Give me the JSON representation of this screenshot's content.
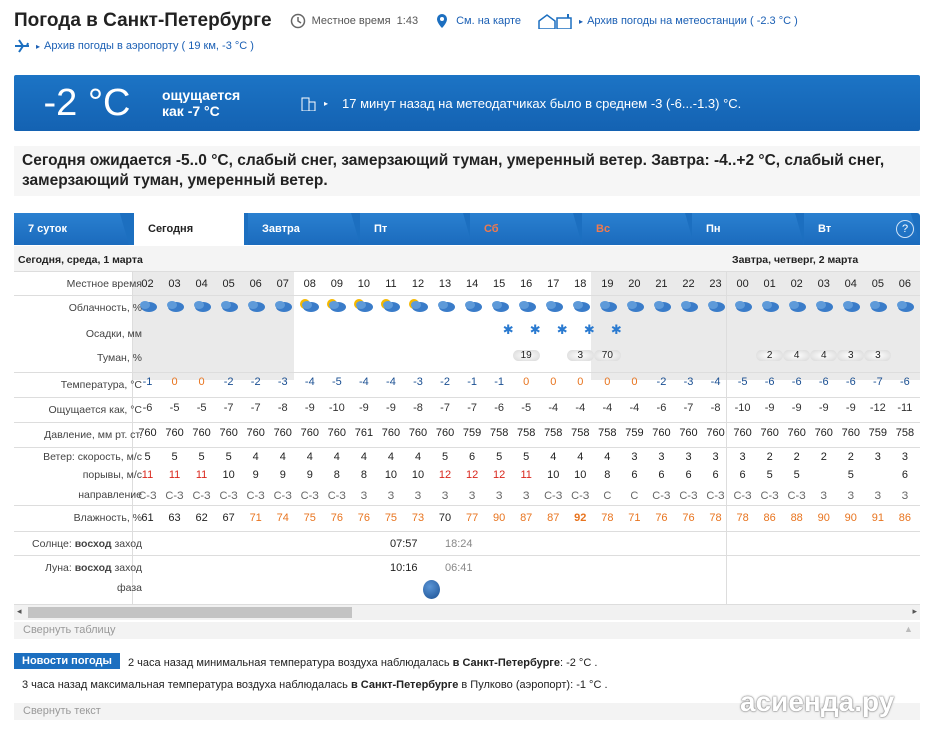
{
  "header": {
    "title": "Погода в Санкт-Петербурге",
    "local_time_label": "Местное время",
    "local_time": "1:43",
    "map_link": "См. на карте",
    "archive_station": "Архив погоды на метеостанции ( -2.3 °C )",
    "archive_airport": "Архив погоды в аэропорту ( 19 км, -3 °C )"
  },
  "current": {
    "temp": "-2 °C",
    "feels_line1": "ощущается",
    "feels_line2": "как -7 °C",
    "sensor_note": "17 минут назад на метеодатчиках было в среднем -3 (-6...-1.3) °C."
  },
  "forecast_text": "Сегодня ожидается -5..0 °C, слабый снег, замерзающий туман, умеренный ветер. Завтра: -4..+2 °C, слабый снег, замерзающий туман, умеренный ветер.",
  "tabs": [
    "7 суток",
    "Сегодня",
    "Завтра",
    "Пт",
    "Сб",
    "Вс",
    "Пн",
    "Вт"
  ],
  "help": "?",
  "day1": "Сегодня, среда, 1 марта",
  "day2": "Завтра, четверг, 2 марта",
  "labels": {
    "time": "Местное время",
    "cloud": "Облачность, %",
    "precip": "Осадки, мм",
    "fog": "Туман, %",
    "temp": "Температура, °C",
    "feels": "Ощущается как, °C",
    "pressure": "Давление, мм рт. ст.",
    "wind_speed": "Ветер: скорость, м/с",
    "gusts": "порывы, м/с",
    "direction": "направление",
    "humidity": "Влажность, %",
    "sun": "Солнце:",
    "moon": "Луна:",
    "rise": "восход",
    "set": "заход",
    "phase": "фаза"
  },
  "hours": [
    "02",
    "03",
    "04",
    "05",
    "06",
    "07",
    "08",
    "09",
    "10",
    "11",
    "12",
    "13",
    "14",
    "15",
    "16",
    "17",
    "18",
    "19",
    "20",
    "21",
    "22",
    "23",
    "00",
    "01",
    "02",
    "03",
    "04",
    "05",
    "06"
  ],
  "temp": [
    "-1",
    "0",
    "0",
    "-2",
    "-2",
    "-3",
    "-4",
    "-5",
    "-4",
    "-4",
    "-3",
    "-2",
    "-1",
    "-1",
    "0",
    "0",
    "0",
    "0",
    "0",
    "-2",
    "-3",
    "-4",
    "-5",
    "-6",
    "-6",
    "-6",
    "-6",
    "-7",
    "-6"
  ],
  "feels": [
    "-6",
    "-5",
    "-5",
    "-7",
    "-7",
    "-8",
    "-9",
    "-10",
    "-9",
    "-9",
    "-8",
    "-7",
    "-7",
    "-6",
    "-5",
    "-4",
    "-4",
    "-4",
    "-4",
    "-6",
    "-7",
    "-8",
    "-10",
    "-9",
    "-9",
    "-9",
    "-9",
    "-12",
    "-11"
  ],
  "pressure": [
    "760",
    "760",
    "760",
    "760",
    "760",
    "760",
    "760",
    "760",
    "761",
    "760",
    "760",
    "760",
    "759",
    "758",
    "758",
    "758",
    "758",
    "758",
    "759",
    "760",
    "760",
    "760",
    "760",
    "760",
    "760",
    "760",
    "760",
    "759",
    "758"
  ],
  "wind": [
    "5",
    "5",
    "5",
    "5",
    "4",
    "4",
    "4",
    "4",
    "4",
    "4",
    "4",
    "5",
    "6",
    "5",
    "5",
    "4",
    "4",
    "4",
    "3",
    "3",
    "3",
    "3",
    "3",
    "2",
    "2",
    "2",
    "2",
    "3",
    "3"
  ],
  "gusts": [
    "11",
    "11",
    "11",
    "10",
    "9",
    "9",
    "9",
    "8",
    "8",
    "10",
    "10",
    "12",
    "12",
    "12",
    "11",
    "10",
    "10",
    "8",
    "6",
    "6",
    "6",
    "6",
    "6",
    "5",
    "5",
    "",
    "5",
    "",
    "6"
  ],
  "dir": [
    "С-З",
    "С-З",
    "С-З",
    "С-З",
    "С-З",
    "С-З",
    "С-З",
    "С-З",
    "З",
    "З",
    "З",
    "З",
    "З",
    "З",
    "З",
    "С-З",
    "С-З",
    "С",
    "С",
    "С-З",
    "С-З",
    "С-З",
    "С-З",
    "С-З",
    "С-З",
    "З",
    "З",
    "З",
    "З"
  ],
  "humidity": [
    "61",
    "63",
    "62",
    "67",
    "71",
    "74",
    "75",
    "76",
    "76",
    "75",
    "73",
    "70",
    "77",
    "90",
    "87",
    "87",
    "92",
    "78",
    "71",
    "76",
    "76",
    "78",
    "78",
    "86",
    "88",
    "90",
    "90",
    "91",
    "86"
  ],
  "fog": {
    "14": "19",
    "16": "3",
    "17": "70",
    "23": "2",
    "24": "4",
    "25": "4",
    "26": "3",
    "27": "3"
  },
  "sun": {
    "rise": "07:57",
    "set": "18:24"
  },
  "moon": {
    "rise": "10:16",
    "set": "06:41"
  },
  "collapse_table": "Свернуть таблицу",
  "news": {
    "badge": "Новости погоды",
    "line1_pre": "2 часа назад минимальная температура воздуха наблюдалась ",
    "line1_bold": "в Санкт-Петербурге",
    "line1_post": ": -2 °C .",
    "line2_pre": "3 часа назад максимальная температура воздуха наблюдалась ",
    "line2_bold": "в Санкт-Петербурге",
    "line2_post": " в Пулково (аэропорт): -1 °C ."
  },
  "collapse_text": "Свернуть текст",
  "watermark": "асиенда.ру",
  "colors": {
    "accent": "#1c6fc0",
    "warm": "#e8741f",
    "red": "#d9261c"
  }
}
